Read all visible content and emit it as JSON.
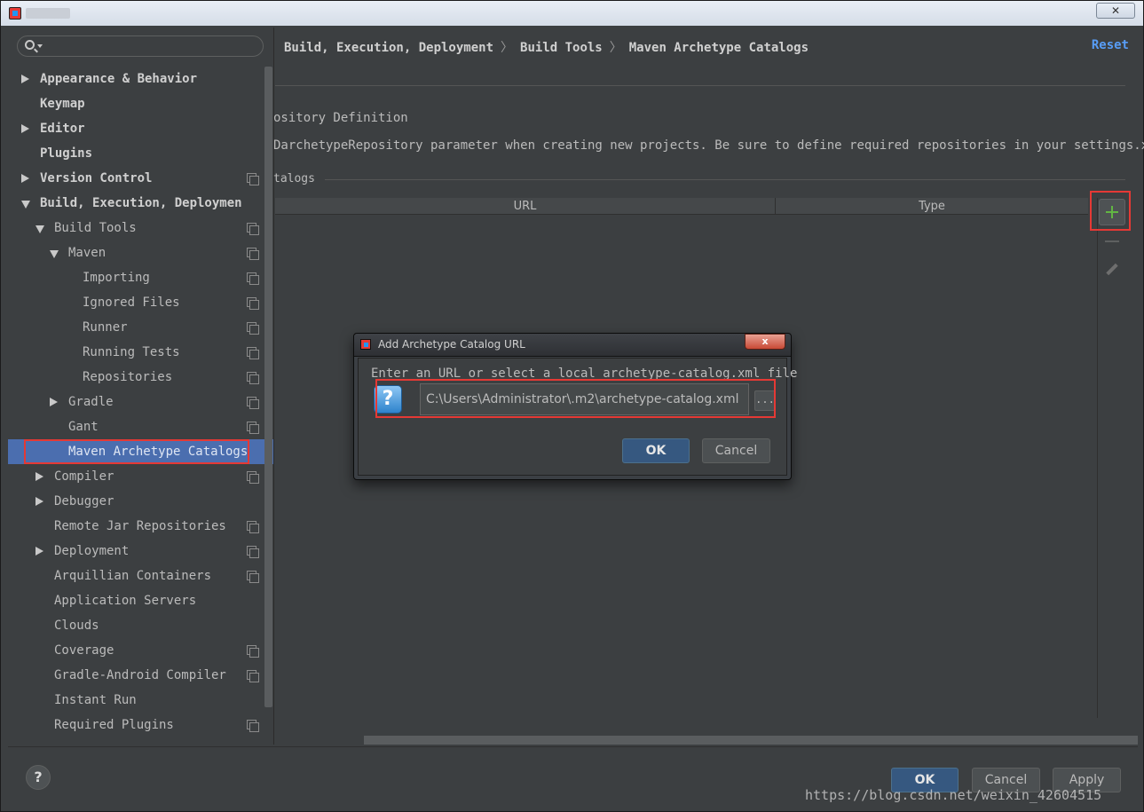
{
  "window": {
    "colors": {
      "accent": "#4b6eaf",
      "highlight": "#e53935",
      "link": "#589df6"
    }
  },
  "search": {
    "placeholder": "",
    "value": ""
  },
  "tree": [
    {
      "label": "Appearance & Behavior",
      "bold": true,
      "arrow": "right",
      "copy": false
    },
    {
      "label": "Keymap",
      "bold": true,
      "arrow": "",
      "copy": false
    },
    {
      "label": "Editor",
      "bold": true,
      "arrow": "right",
      "copy": false
    },
    {
      "label": "Plugins",
      "bold": true,
      "arrow": "",
      "copy": false
    },
    {
      "label": "Version Control",
      "bold": true,
      "arrow": "right",
      "copy": true
    },
    {
      "label": "Build, Execution, Deploymen",
      "bold": true,
      "arrow": "down",
      "copy": false
    },
    {
      "label": "Build Tools",
      "bold": false,
      "arrow": "down",
      "copy": true
    },
    {
      "label": "Maven",
      "bold": false,
      "arrow": "down",
      "copy": true
    },
    {
      "label": "Importing",
      "bold": false,
      "arrow": "",
      "copy": true
    },
    {
      "label": "Ignored Files",
      "bold": false,
      "arrow": "",
      "copy": true
    },
    {
      "label": "Runner",
      "bold": false,
      "arrow": "",
      "copy": true
    },
    {
      "label": "Running Tests",
      "bold": false,
      "arrow": "",
      "copy": true
    },
    {
      "label": "Repositories",
      "bold": false,
      "arrow": "",
      "copy": true
    },
    {
      "label": "Gradle",
      "bold": false,
      "arrow": "right",
      "copy": true
    },
    {
      "label": "Gant",
      "bold": false,
      "arrow": "",
      "copy": true
    },
    {
      "label": "Maven Archetype Catalogs",
      "bold": false,
      "arrow": "",
      "copy": false,
      "selected": true
    },
    {
      "label": "Compiler",
      "bold": false,
      "arrow": "right",
      "copy": true
    },
    {
      "label": "Debugger",
      "bold": false,
      "arrow": "right",
      "copy": false
    },
    {
      "label": "Remote Jar Repositories",
      "bold": false,
      "arrow": "",
      "copy": true
    },
    {
      "label": "Deployment",
      "bold": false,
      "arrow": "right",
      "copy": true
    },
    {
      "label": "Arquillian Containers",
      "bold": false,
      "arrow": "",
      "copy": true
    },
    {
      "label": "Application Servers",
      "bold": false,
      "arrow": "",
      "copy": false
    },
    {
      "label": "Clouds",
      "bold": false,
      "arrow": "",
      "copy": false
    },
    {
      "label": "Coverage",
      "bold": false,
      "arrow": "",
      "copy": true
    },
    {
      "label": "Gradle-Android Compiler",
      "bold": false,
      "arrow": "",
      "copy": true
    },
    {
      "label": "Instant Run",
      "bold": false,
      "arrow": "",
      "copy": false
    },
    {
      "label": "Required Plugins",
      "bold": false,
      "arrow": "",
      "copy": true
    }
  ],
  "header": {
    "crumbs": [
      "Build, Execution, Deployment",
      "Build Tools",
      "Maven Archetype Catalogs"
    ],
    "separator": "〉",
    "reset": "Reset"
  },
  "main": {
    "section_title": "ository Definition",
    "description": "DarchetypeRepository parameter when creating new projects. Be sure to define required repositories in your settings.xml.",
    "catalogs_label": "talogs",
    "columns": {
      "url": "URL",
      "type": "Type"
    }
  },
  "dialog": {
    "title": "Add Archetype Catalog URL",
    "close": "x",
    "prompt": "Enter an URL or select a local archetype-catalog.xml file",
    "url_value": "C:\\Users\\Administrator\\.m2\\archetype-catalog.xml",
    "browse": "...",
    "ok": "OK",
    "cancel": "Cancel"
  },
  "footer": {
    "help": "?",
    "ok": "OK",
    "cancel": "Cancel",
    "apply": "Apply",
    "watermark": "https://blog.csdn.net/weixin_42604515"
  }
}
